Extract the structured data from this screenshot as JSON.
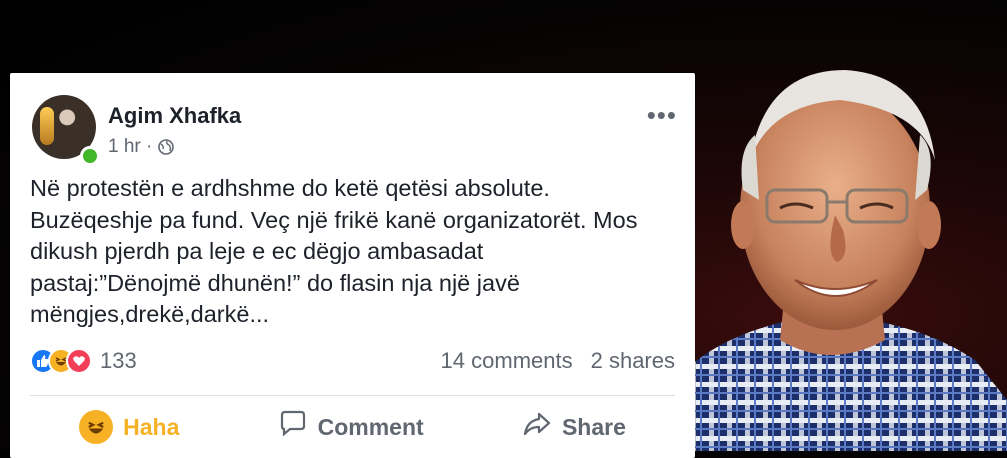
{
  "post": {
    "author": "Agim Xhafka",
    "time": "1 hr ·",
    "text": "Në protestën e ardhshme do ketë qetësi absolute.\nBuzëqeshje pa fund. Veç një frikë kanë organizatorët. Mos\ndikush pjerdh pa leje e ec dëgjo ambasadat\npastaj:”Dënojmë dhunën!” do flasin nja një javë\nmëngjes,drekë,darkë...",
    "more_label": "•••"
  },
  "stats": {
    "reactions_count": "133",
    "comments": "14 comments",
    "shares": "2 shares"
  },
  "actions": {
    "haha": "Haha",
    "comment": "Comment",
    "share": "Share"
  },
  "icons": {
    "like": "like-reaction-icon",
    "haha": "haha-reaction-icon",
    "love": "love-reaction-icon",
    "globe": "globe-icon",
    "comment": "comment-icon",
    "share": "share-icon"
  },
  "colors": {
    "reaction_haha": "#f7b125",
    "reaction_like": "#1877f2",
    "reaction_love": "#f33e58",
    "online": "#42b72a"
  }
}
